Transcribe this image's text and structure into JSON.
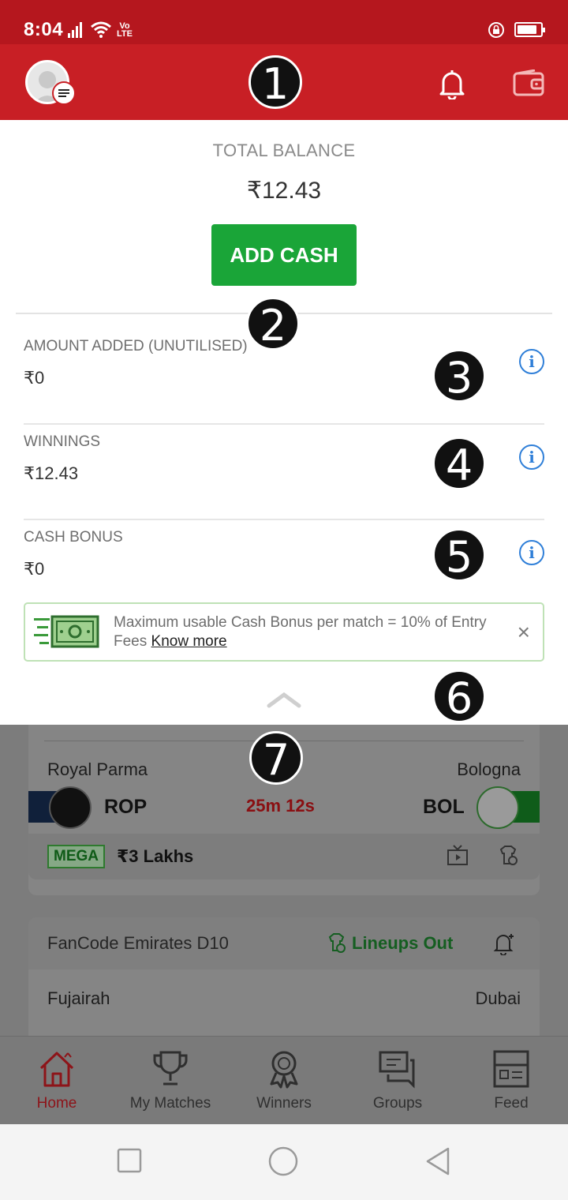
{
  "status_bar": {
    "time": "8:04",
    "volte_top": "Vo",
    "volte_bottom": "LTE"
  },
  "header": {
    "avatar_icon": "avatar-icon",
    "notification_icon": "bell-icon",
    "wallet_icon": "wallet-icon"
  },
  "balance": {
    "total_label": "TOTAL BALANCE",
    "total_amount": "₹12.43",
    "add_cash_label": "ADD CASH",
    "rows": [
      {
        "label": "AMOUNT ADDED (UNUTILISED)",
        "value": "₹0"
      },
      {
        "label": "WINNINGS",
        "value": "₹12.43"
      },
      {
        "label": "CASH BONUS",
        "value": "₹0"
      }
    ],
    "info_glyph": "i",
    "notice": {
      "text": "Maximum usable Cash Bonus per match = 10% of Entry Fees ",
      "link": "Know more",
      "close": "×"
    }
  },
  "markers": [
    "1",
    "2",
    "3",
    "4",
    "5",
    "6",
    "7"
  ],
  "background": {
    "match1": {
      "team1_name": "Royal Parma",
      "team2_name": "Bologna",
      "team1_code": "ROP",
      "team2_code": "BOL",
      "countdown": "25m 12s",
      "badge": "MEGA",
      "prize": "₹3 Lakhs"
    },
    "match2": {
      "league": "FanCode Emirates D10",
      "status": "Lineups Out",
      "team1_name": "Fujairah",
      "team2_name": "Dubai"
    }
  },
  "bottom_nav": [
    {
      "label": "Home",
      "active": true
    },
    {
      "label": "My Matches",
      "active": false
    },
    {
      "label": "Winners",
      "active": false
    },
    {
      "label": "Groups",
      "active": false
    },
    {
      "label": "Feed",
      "active": false
    }
  ],
  "colors": {
    "brand_red": "#c81f25",
    "add_cash_green": "#1aa538",
    "info_blue": "#2f7fd8"
  }
}
